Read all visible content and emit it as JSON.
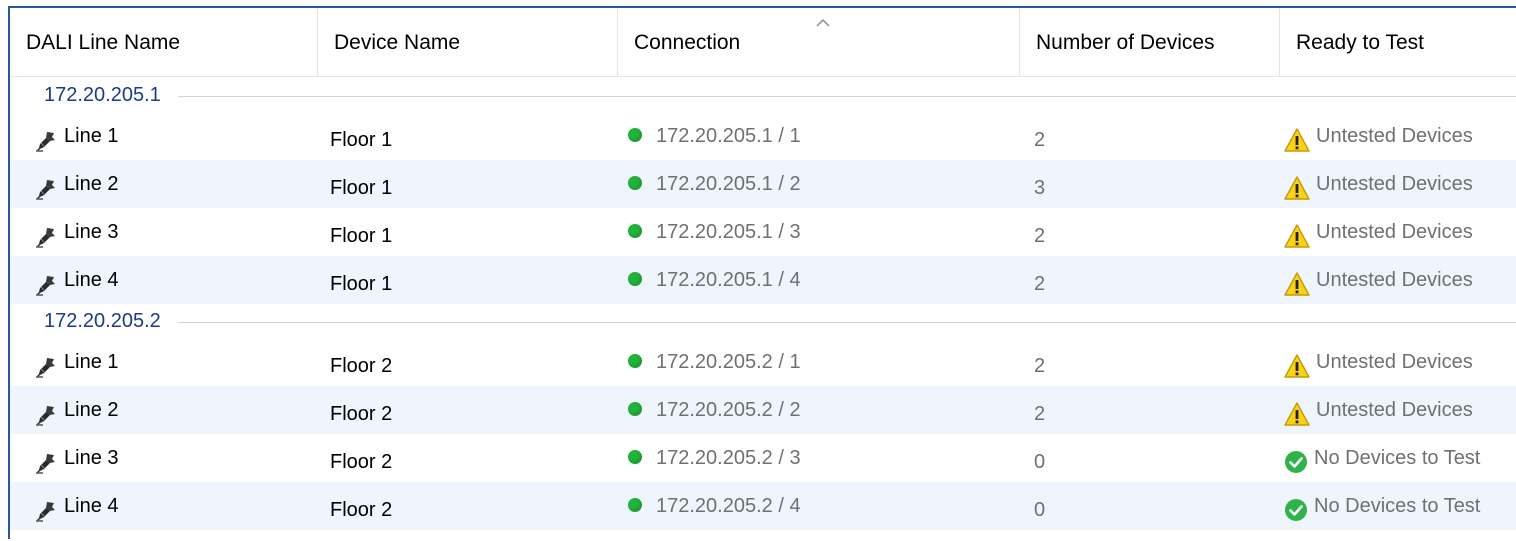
{
  "columns": {
    "line_name": "DALI Line Name",
    "device_name": "Device Name",
    "connection": "Connection",
    "num_devices": "Number of Devices",
    "ready": "Ready to Test"
  },
  "sort": {
    "column": "connection",
    "direction": "ascending"
  },
  "colors": {
    "group_text": "#1e3a8a",
    "status_ok": "#22b33a",
    "warn": "#f5c518",
    "row_alt": "#eef5fd"
  },
  "groups": [
    {
      "label": "172.20.205.1",
      "rows": [
        {
          "line": "Line 1",
          "device": "Floor 1",
          "connection": "172.20.205.1 / 1",
          "count": "2",
          "ready": "Untested Devices",
          "ready_icon": "warning-icon"
        },
        {
          "line": "Line 2",
          "device": "Floor 1",
          "connection": "172.20.205.1 / 2",
          "count": "3",
          "ready": "Untested Devices",
          "ready_icon": "warning-icon"
        },
        {
          "line": "Line 3",
          "device": "Floor 1",
          "connection": "172.20.205.1 / 3",
          "count": "2",
          "ready": "Untested Devices",
          "ready_icon": "warning-icon"
        },
        {
          "line": "Line 4",
          "device": "Floor 1",
          "connection": "172.20.205.1 / 4",
          "count": "2",
          "ready": "Untested Devices",
          "ready_icon": "warning-icon"
        }
      ]
    },
    {
      "label": "172.20.205.2",
      "rows": [
        {
          "line": "Line 1",
          "device": "Floor 2",
          "connection": "172.20.205.2 / 1",
          "count": "2",
          "ready": "Untested Devices",
          "ready_icon": "warning-icon"
        },
        {
          "line": "Line 2",
          "device": "Floor 2",
          "connection": "172.20.205.2 / 2",
          "count": "2",
          "ready": "Untested Devices",
          "ready_icon": "warning-icon"
        },
        {
          "line": "Line 3",
          "device": "Floor 2",
          "connection": "172.20.205.2 / 3",
          "count": "0",
          "ready": "No Devices to Test",
          "ready_icon": "check-icon"
        },
        {
          "line": "Line 4",
          "device": "Floor 2",
          "connection": "172.20.205.2 / 4",
          "count": "0",
          "ready": "No Devices to Test",
          "ready_icon": "check-icon"
        }
      ]
    }
  ]
}
